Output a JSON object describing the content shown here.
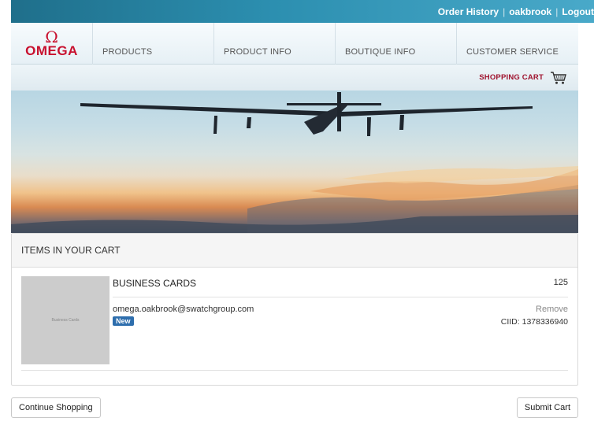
{
  "topbar": {
    "order_history": "Order History",
    "user": "oakbrook",
    "logout": "Logout",
    "separator": "|"
  },
  "brand": {
    "symbol": "Ω",
    "name": "OMEGA",
    "color": "#c8102e"
  },
  "nav": {
    "items": [
      {
        "label": "PRODUCTS"
      },
      {
        "label": "PRODUCT INFO"
      },
      {
        "label": "BOUTIQUE INFO"
      },
      {
        "label": "CUSTOMER SERVICE"
      }
    ]
  },
  "cart_strip": {
    "label": "SHOPPING CART",
    "icon": "shopping-cart-icon"
  },
  "hero": {
    "image": "solar-airplane-banner"
  },
  "cart": {
    "heading": "ITEMS IN YOUR CART",
    "items": [
      {
        "thumbnail_text": "Business Cards",
        "title": "BUSINESS CARDS",
        "quantity": "125",
        "email": "omega.oakbrook@swatchgroup.com",
        "badge": "New",
        "remove_label": "Remove",
        "ciid": "CIID: 1378336940"
      }
    ]
  },
  "actions": {
    "continue_label": "Continue Shopping",
    "submit_label": "Submit Cart"
  },
  "colors": {
    "accent_red": "#a0142f",
    "badge_blue": "#2e6ead"
  }
}
